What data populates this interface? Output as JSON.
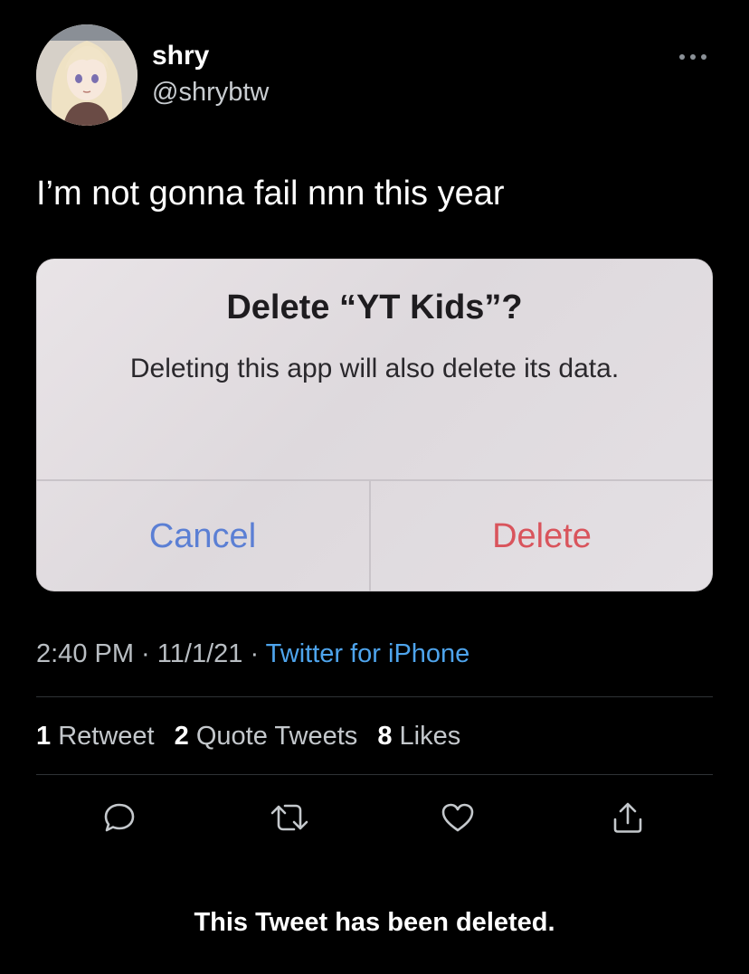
{
  "author": {
    "display_name": "shry",
    "handle": "@shrybtw",
    "avatar_icon": "anime-character-avatar"
  },
  "more_icon": "more-dots-icon",
  "tweet": {
    "text": "I’m not gonna fail nnn this year"
  },
  "media": {
    "alert_title": "Delete “YT Kids”?",
    "alert_message": "Deleting this app will also delete its data.",
    "cancel_label": "Cancel",
    "delete_label": "Delete",
    "colors": {
      "cancel": "#5b7fd4",
      "delete": "#d9545c"
    }
  },
  "meta": {
    "time": "2:40 PM",
    "separator": " · ",
    "date": "11/1/21",
    "source": "Twitter for iPhone"
  },
  "stats": {
    "retweets": {
      "count": "1",
      "label": "Retweet"
    },
    "quotes": {
      "count": "2",
      "label": "Quote Tweets"
    },
    "likes": {
      "count": "8",
      "label": "Likes"
    }
  },
  "actions": [
    {
      "name": "reply",
      "icon": "reply-bubble-icon"
    },
    {
      "name": "retweet",
      "icon": "retweet-arrows-icon"
    },
    {
      "name": "like",
      "icon": "heart-icon"
    },
    {
      "name": "share",
      "icon": "share-upload-icon"
    }
  ],
  "notice": "This Tweet has been deleted.",
  "colors": {
    "background": "#000000",
    "link": "#4ea4ec",
    "divider": "#2f3336"
  }
}
